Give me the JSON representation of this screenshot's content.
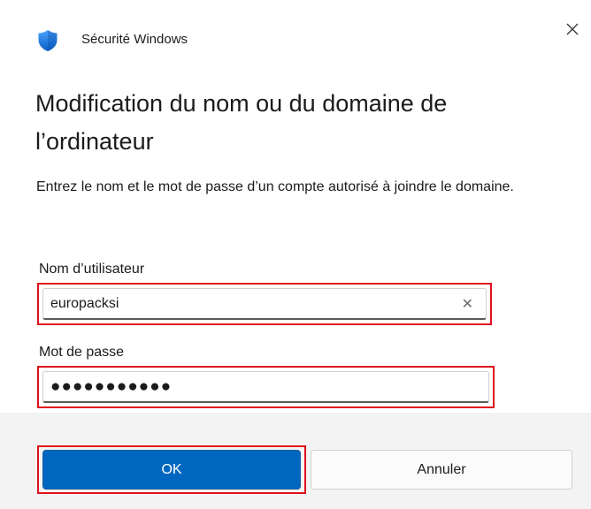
{
  "window": {
    "app_title": "Sécurité Windows",
    "app_icon": "windows-security-shield-icon",
    "close_glyph": "✕"
  },
  "dialog": {
    "heading": "Modification du nom ou du domaine de l’ordinateur",
    "description": "Entrez le nom et le mot de passe d’un compte autorisé à joindre le domaine."
  },
  "form": {
    "username": {
      "label": "Nom d’utilisateur",
      "value": "europacksi",
      "clear_glyph": "✕"
    },
    "password": {
      "label": "Mot de passe",
      "masked_value": "●●●●●●●●●●●"
    }
  },
  "buttons": {
    "ok_label": "OK",
    "cancel_label": "Annuler"
  },
  "colors": {
    "accent": "#0067c0",
    "highlight_outline": "#e0101e",
    "footer_bg": "#f3f3f3"
  }
}
